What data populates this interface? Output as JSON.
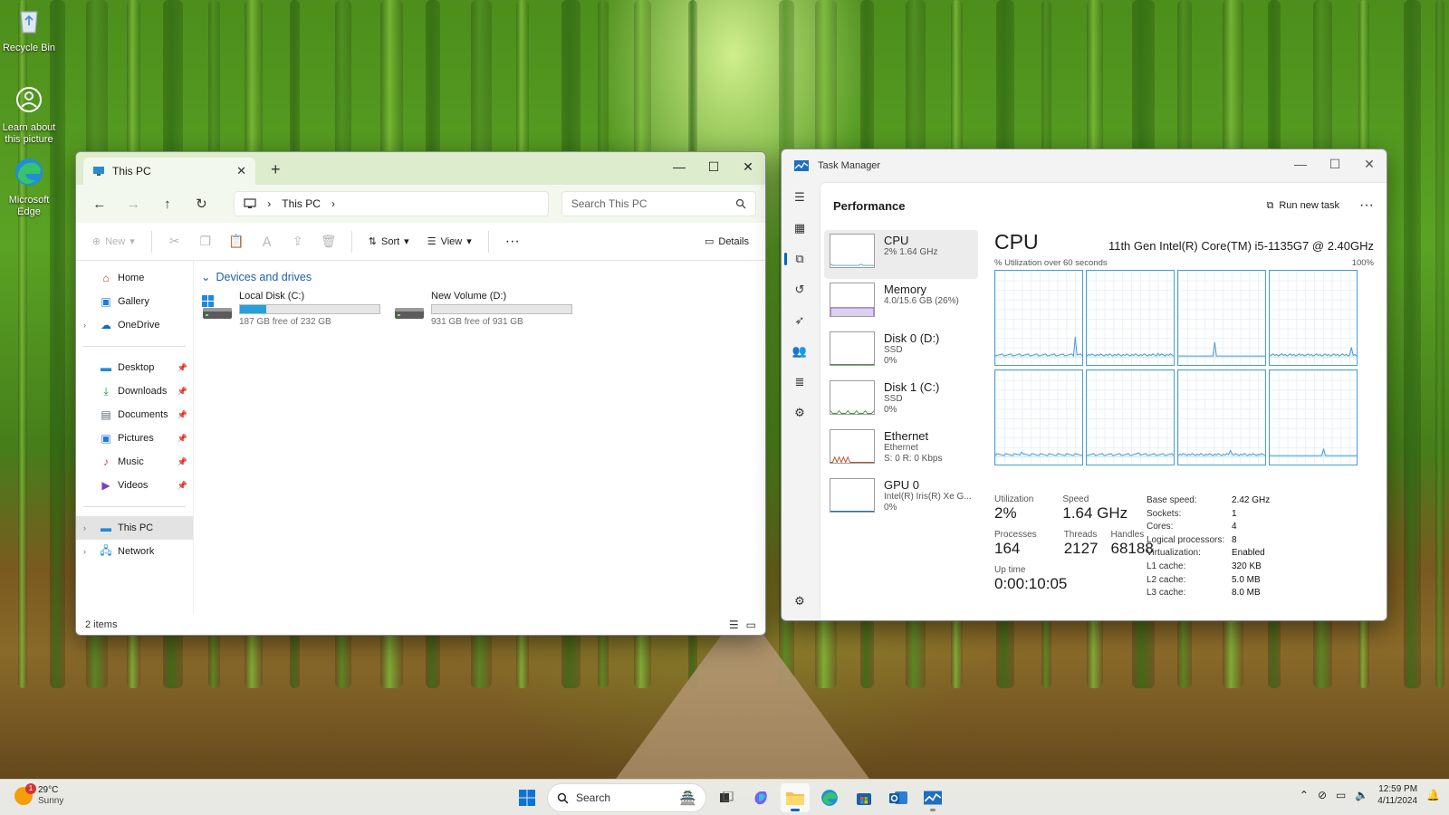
{
  "desktop": {
    "icons": [
      {
        "label": "Recycle Bin"
      },
      {
        "label": "Learn about this picture"
      },
      {
        "label": "Microsoft Edge"
      }
    ]
  },
  "explorer": {
    "tab_title": "This PC",
    "address_segment": "This PC",
    "search_placeholder": "Search This PC",
    "toolbar": {
      "new_label": "New",
      "sort_label": "Sort",
      "view_label": "View",
      "details_label": "Details"
    },
    "nav": {
      "top": [
        {
          "label": "Home",
          "icon": "home-icon"
        },
        {
          "label": "Gallery",
          "icon": "gallery-icon"
        },
        {
          "label": "OneDrive",
          "icon": "cloud-icon"
        }
      ],
      "quick_access": [
        {
          "label": "Desktop",
          "icon": "desktop-folder-icon"
        },
        {
          "label": "Downloads",
          "icon": "download-icon"
        },
        {
          "label": "Documents",
          "icon": "documents-icon"
        },
        {
          "label": "Pictures",
          "icon": "pictures-icon"
        },
        {
          "label": "Music",
          "icon": "music-icon"
        },
        {
          "label": "Videos",
          "icon": "videos-icon"
        }
      ],
      "bottom": [
        {
          "label": "This PC",
          "icon": "pc-icon"
        },
        {
          "label": "Network",
          "icon": "network-icon"
        }
      ]
    },
    "group_header": "Devices and drives",
    "drives": [
      {
        "name": "Local Disk (C:)",
        "free_text": "187 GB free of 232 GB",
        "used_fraction": 0.19
      },
      {
        "name": "New Volume (D:)",
        "free_text": "931 GB free of 931 GB",
        "used_fraction": 0.0
      }
    ],
    "status": "2 items"
  },
  "taskmgr": {
    "title": "Task Manager",
    "section": "Performance",
    "run_new_task": "Run new task",
    "list": [
      {
        "name": "CPU",
        "sub1": "2% 1.64 GHz",
        "sub2": ""
      },
      {
        "name": "Memory",
        "sub1": "4.0/15.6 GB (26%)",
        "sub2": ""
      },
      {
        "name": "Disk 0 (D:)",
        "sub1": "SSD",
        "sub2": "0%"
      },
      {
        "name": "Disk 1 (C:)",
        "sub1": "SSD",
        "sub2": "0%"
      },
      {
        "name": "Ethernet",
        "sub1": "Ethernet",
        "sub2": "S: 0 R: 0 Kbps"
      },
      {
        "name": "GPU 0",
        "sub1": "Intel(R) Iris(R) Xe G...",
        "sub2": "0%"
      }
    ],
    "detail": {
      "heading": "CPU",
      "model": "11th Gen Intel(R) Core(TM) i5-1135G7 @ 2.40GHz",
      "graph_caption": "% Utilization over 60 seconds",
      "graph_max": "100%",
      "utilization_label": "Utilization",
      "utilization": "2%",
      "speed_label": "Speed",
      "speed": "1.64 GHz",
      "processes_label": "Processes",
      "processes": "164",
      "threads_label": "Threads",
      "threads": "2127",
      "handles_label": "Handles",
      "handles": "68188",
      "uptime_label": "Up time",
      "uptime": "0:00:10:05",
      "specs": [
        {
          "k": "Base speed:",
          "v": "2.42 GHz"
        },
        {
          "k": "Sockets:",
          "v": "1"
        },
        {
          "k": "Cores:",
          "v": "4"
        },
        {
          "k": "Logical processors:",
          "v": "8"
        },
        {
          "k": "Virtualization:",
          "v": "Enabled"
        },
        {
          "k": "L1 cache:",
          "v": "320 KB"
        },
        {
          "k": "L2 cache:",
          "v": "5.0 MB"
        },
        {
          "k": "L3 cache:",
          "v": "8.0 MB"
        }
      ]
    }
  },
  "taskbar": {
    "weather_temp": "29°C",
    "weather_desc": "Sunny",
    "weather_badge": "1",
    "search_label": "Search",
    "time": "12:59 PM",
    "date": "4/11/2024"
  },
  "colors": {
    "accent": "#0067c0",
    "graph_line": "#4a9fd4",
    "drive_fill": "#26a0da"
  }
}
